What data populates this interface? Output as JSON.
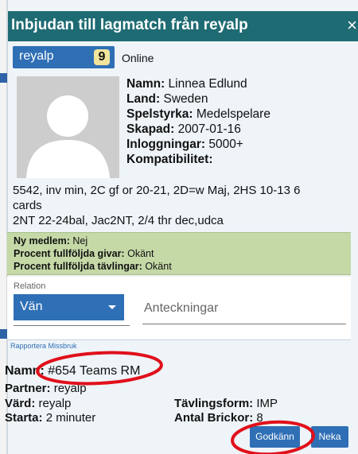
{
  "dialog": {
    "title": "Inbjudan till lagmatch från reyalp",
    "close_symbol": "×",
    "user": {
      "name": "reyalp",
      "count": "9",
      "status": "Online"
    },
    "profile": [
      {
        "label": "Namn:",
        "value": "Linnea Edlund"
      },
      {
        "label": "Land:",
        "value": "Sweden"
      },
      {
        "label": "Spelstyrka:",
        "value": "Medelspelare"
      },
      {
        "label": "Skapad:",
        "value": "2007-01-16"
      },
      {
        "label": "Inloggningar:",
        "value": "5000+"
      },
      {
        "label": "Kompatibilitet:",
        "value": ""
      }
    ],
    "description_lines": [
      "5542, inv min, 2C gf or 20-21, 2D=w Maj, 2HS 10-13 6",
      "cards",
      "2NT 22-24bal, Jac2NT, 2/4 thr dec,udca"
    ],
    "member_info": [
      {
        "label": "Ny medlem:",
        "value": "Nej"
      },
      {
        "label": "Procent fullföljda givar:",
        "value": "Okänt"
      },
      {
        "label": "Procent fullföljda tävlingar:",
        "value": "Okänt"
      }
    ],
    "relation": {
      "label": "Relation",
      "value": "Vän"
    },
    "notes_placeholder": "Anteckningar",
    "report_link": "Rapportera Missbruk",
    "match": {
      "name_label": "Namn:",
      "name_value": "#654 Teams RM",
      "partner_label": "Partner:",
      "partner_value": "reyalp",
      "host_label": "Värd:",
      "host_value": "reyalp",
      "start_label": "Starta:",
      "start_value": "2 minuter",
      "format_label": "Tävlingsform:",
      "format_value": "IMP",
      "boards_label": "Antal Brickor:",
      "boards_value": "8"
    },
    "buttons": {
      "accept": "Godkänn",
      "decline": "Neka"
    }
  },
  "colors": {
    "titlebar": "#1f6b73",
    "primary_blue": "#2f6fb5",
    "member_box_green": "#c5d9a7",
    "annotation_red": "#e0101a"
  }
}
